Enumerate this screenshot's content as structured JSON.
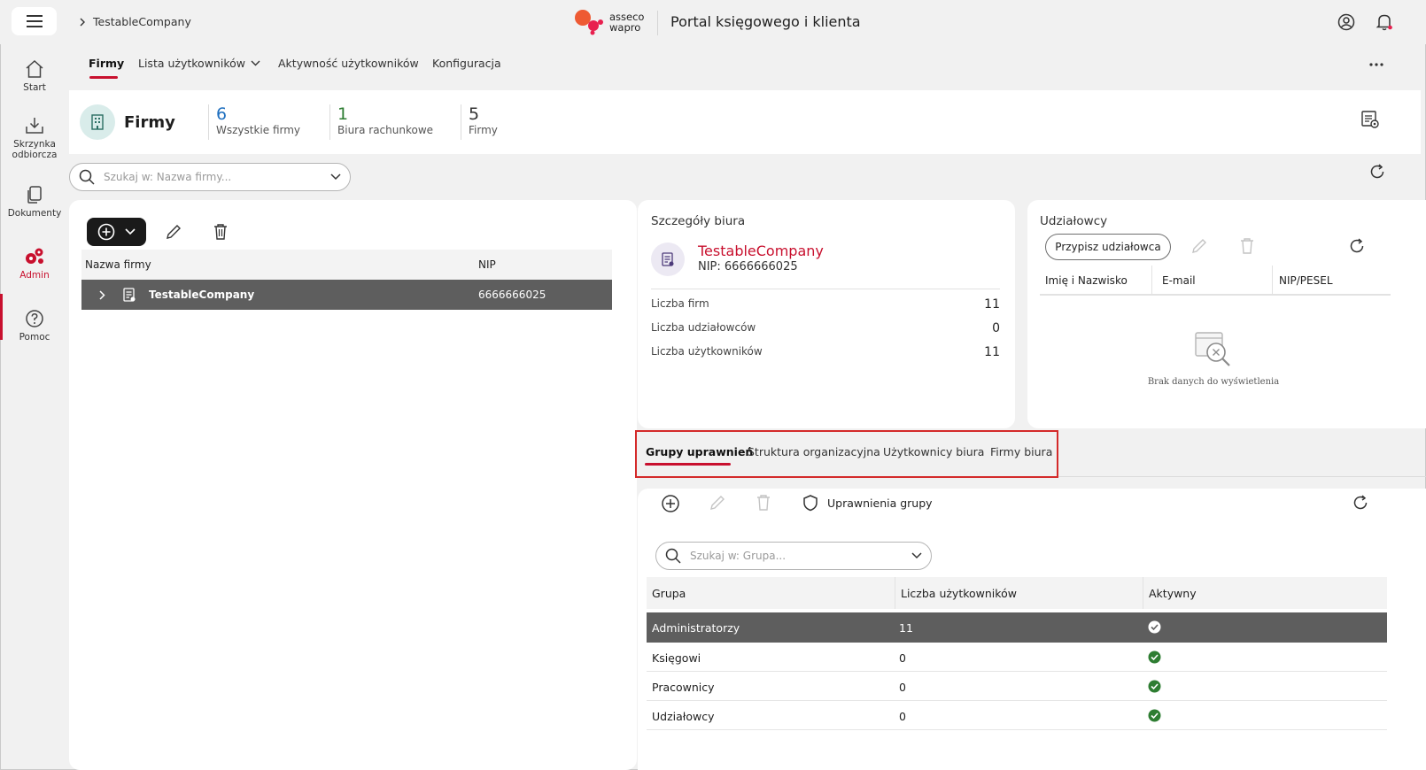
{
  "topbar": {
    "breadcrumb": "TestableCompany",
    "logo_line1": "asseco",
    "logo_line2": "wapro",
    "portal_title": "Portal księgowego i klienta"
  },
  "sidenav": {
    "items": [
      {
        "label": "Start",
        "icon": "home-icon"
      },
      {
        "label": "Skrzynka odbiorcza",
        "icon": "inbox-download-icon"
      },
      {
        "label": "Dokumenty",
        "icon": "documents-icon"
      },
      {
        "label": "Admin",
        "icon": "admin-gears-icon"
      },
      {
        "label": "Pomoc",
        "icon": "help-icon"
      }
    ]
  },
  "tabs": [
    {
      "label": "Firmy"
    },
    {
      "label": "Lista użytkowników"
    },
    {
      "label": "Aktywność użytkowników"
    },
    {
      "label": "Konfiguracja"
    }
  ],
  "header": {
    "title": "Firmy",
    "stats": [
      {
        "value": "6",
        "label": "Wszystkie firmy",
        "color": "#1f6fbf"
      },
      {
        "value": "1",
        "label": "Biura rachunkowe",
        "color": "#2e7d32"
      },
      {
        "value": "5",
        "label": "Firmy",
        "color": "#333333"
      }
    ]
  },
  "search_main": {
    "placeholder": "Szukaj w: Nazwa firmy..."
  },
  "companies": {
    "columns": [
      "Nazwa firmy",
      "NIP"
    ],
    "rows": [
      {
        "name": "TestableCompany",
        "nip": "6666666025"
      }
    ]
  },
  "details": {
    "title": "Szczegóły biura",
    "name": "TestableCompany",
    "nip": "NIP: 6666666025",
    "rows": [
      {
        "label": "Liczba firm",
        "value": "11"
      },
      {
        "label": "Liczba udziałowców",
        "value": "0"
      },
      {
        "label": "Liczba użytkowników",
        "value": "11"
      }
    ]
  },
  "shareholders": {
    "title": "Udziałowcy",
    "assign_button": "Przypisz udziałowca",
    "columns": [
      "Imię i Nazwisko",
      "E-mail",
      "NIP/PESEL"
    ],
    "empty_text": "Brak danych do wyświetlenia"
  },
  "group_tabs": [
    {
      "label": "Grupy uprawnień"
    },
    {
      "label": "Struktura organizacyjna"
    },
    {
      "label": "Użytkownicy biura"
    },
    {
      "label": "Firmy biura"
    }
  ],
  "groups": {
    "permissions_button": "Uprawnienia grupy",
    "search_placeholder": "Szukaj w: Grupa...",
    "columns": [
      "Grupa",
      "Liczba użytkowników",
      "Aktywny"
    ],
    "rows": [
      {
        "name": "Administratorzy",
        "count": "11"
      },
      {
        "name": "Księgowi",
        "count": "0"
      },
      {
        "name": "Pracownicy",
        "count": "0"
      },
      {
        "name": "Udziałowcy",
        "count": "0"
      }
    ]
  },
  "colors": {
    "accent": "#c8102e",
    "active_check": "#2e7d32"
  }
}
